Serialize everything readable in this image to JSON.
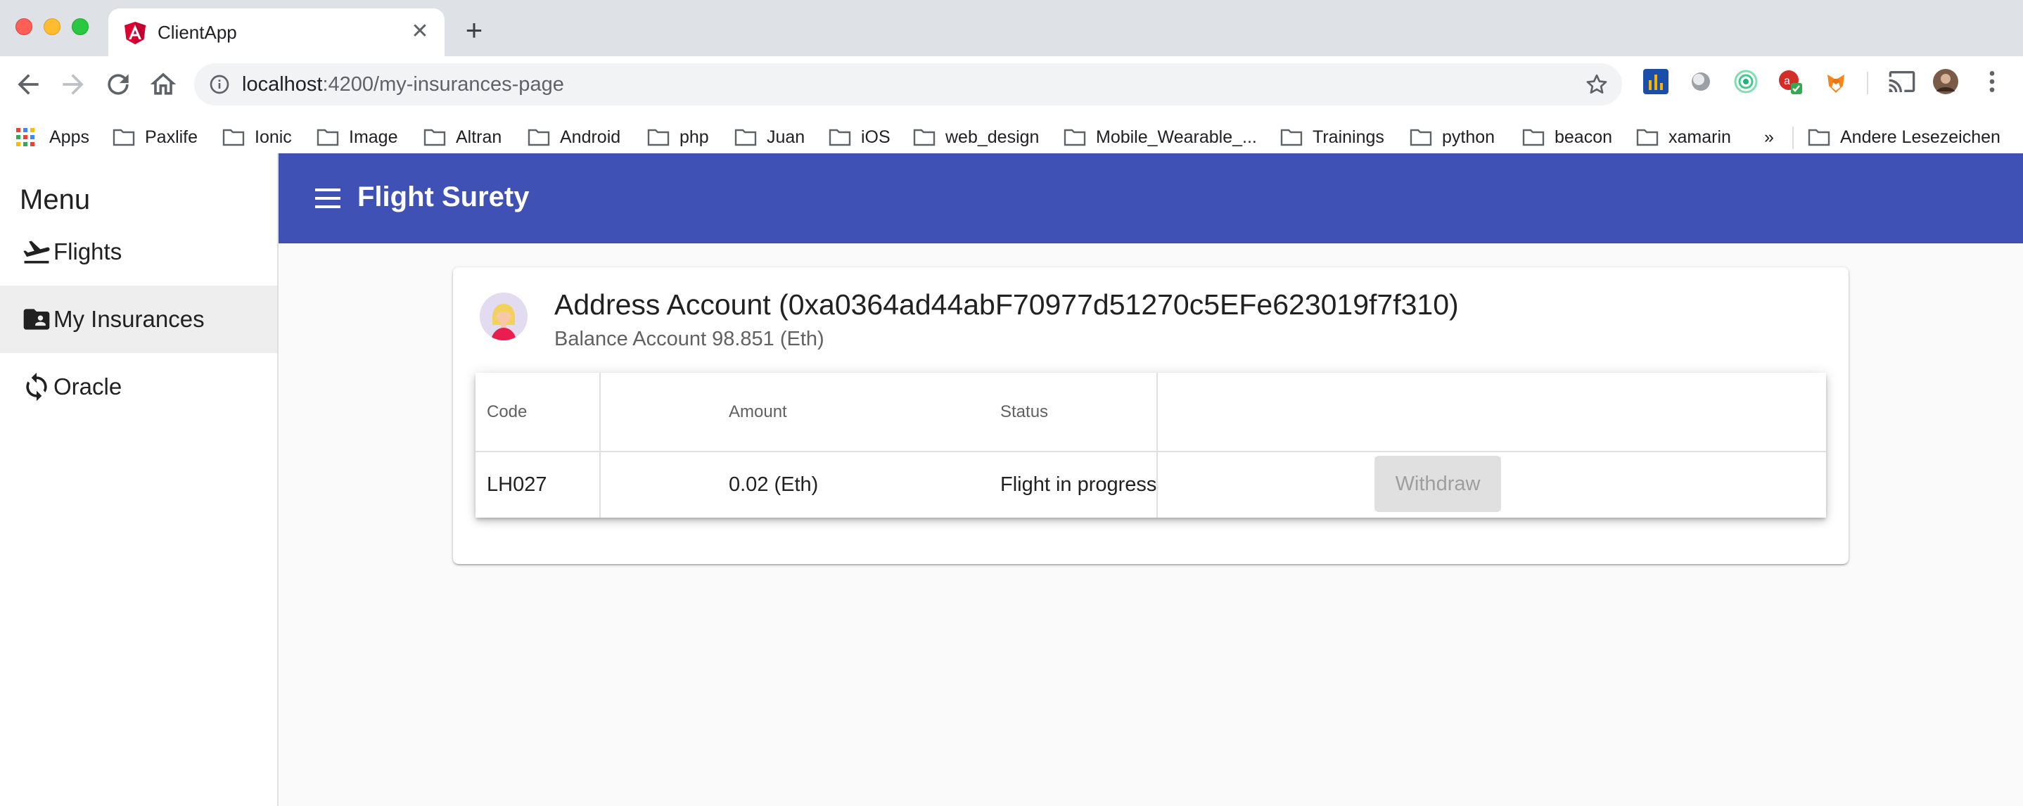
{
  "browser": {
    "tab_title": "ClientApp",
    "url_host": "localhost",
    "url_path": ":4200/my-insurances-page",
    "bookmarks": [
      "Apps",
      "Paxlife",
      "Ionic",
      "Image",
      "Altran",
      "Android",
      "php",
      "Juan",
      "iOS",
      "web_design",
      "Mobile_Wearable_...",
      "Trainings",
      "python",
      "beacon",
      "xamarin"
    ],
    "overflow_label": "»",
    "other_bookmarks": "Andere Lesezeichen"
  },
  "sidebar": {
    "title": "Menu",
    "items": [
      {
        "label": "Flights",
        "icon": "flight-takeoff-icon",
        "active": false
      },
      {
        "label": "My Insurances",
        "icon": "contacts-folder-icon",
        "active": true
      },
      {
        "label": "Oracle",
        "icon": "sync-icon",
        "active": false
      }
    ]
  },
  "appbar": {
    "title": "Flight Surety"
  },
  "account": {
    "title": "Address Account (0xa0364ad44abF70977d51270c5EFe623019f7f310)",
    "balance": "Balance Account 98.851 (Eth)"
  },
  "table": {
    "headers": {
      "code": "Code",
      "amount": "Amount",
      "status": "Status"
    },
    "rows": [
      {
        "code": "LH027",
        "amount": "0.02 (Eth)",
        "status": "Flight in progress",
        "action": "Withdraw",
        "action_enabled": false
      }
    ]
  },
  "colors": {
    "primary": "#3f51b5",
    "active_nav": "#eeeeee",
    "disabled_button": "#e0e0e0"
  }
}
